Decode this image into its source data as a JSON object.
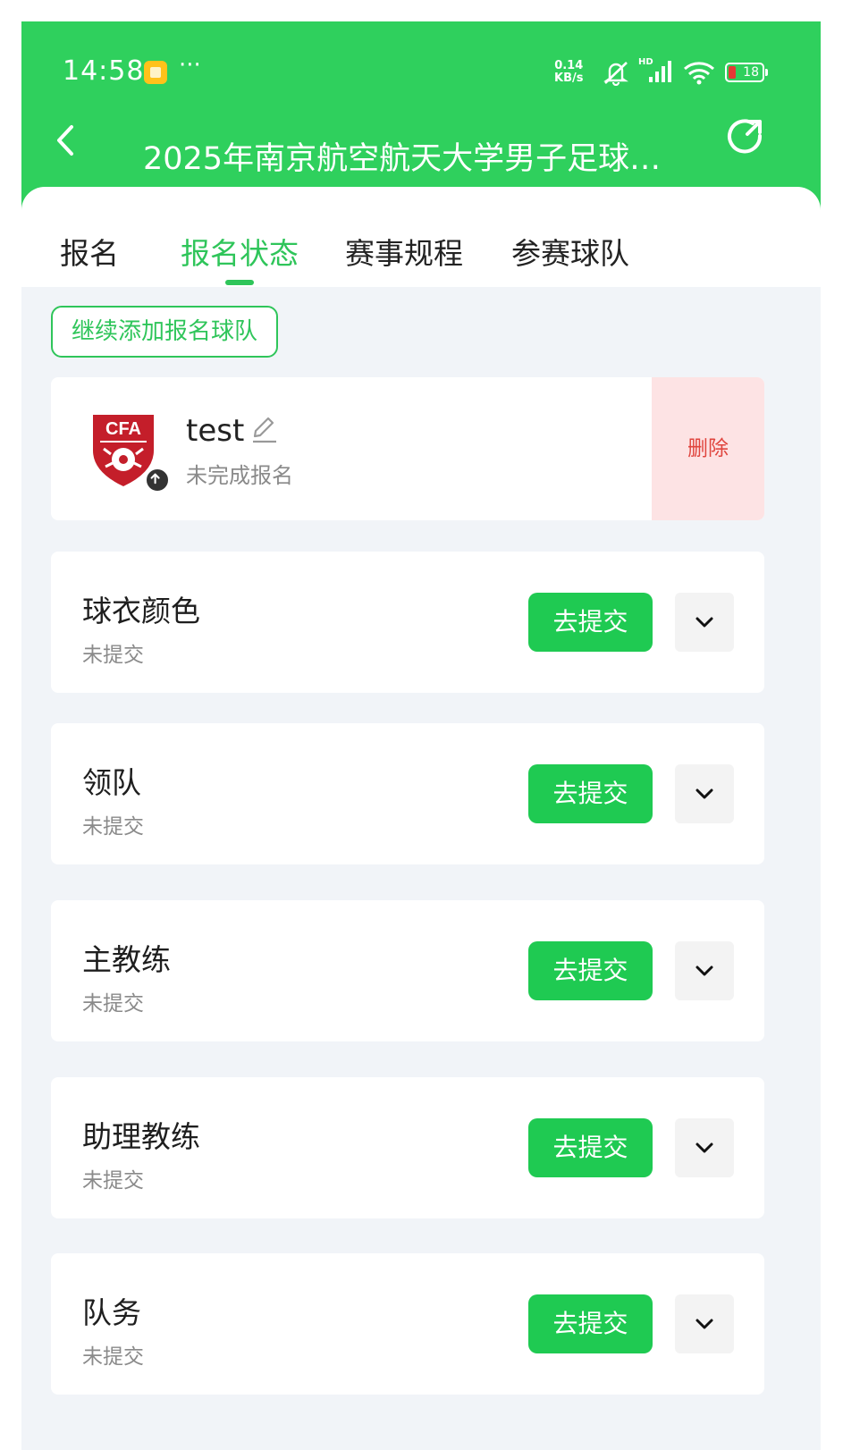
{
  "status_bar": {
    "time": "14:58",
    "net_speed_value": "0.14",
    "net_speed_unit": "KB/s",
    "hd_label": "HD",
    "battery": "18"
  },
  "header": {
    "title": "2025年南京航空航天大学男子足球…"
  },
  "tabs": [
    {
      "label": "报名"
    },
    {
      "label": "报名状态"
    },
    {
      "label": "赛事规程"
    },
    {
      "label": "参赛球队"
    }
  ],
  "add_team_label": "继续添加报名球队",
  "team": {
    "logo_text": "CFA",
    "name": "test",
    "status": "未完成报名",
    "delete_label": "删除"
  },
  "sections": [
    {
      "title": "球衣颜色",
      "status": "未提交",
      "action": "去提交"
    },
    {
      "title": "领队",
      "status": "未提交",
      "action": "去提交"
    },
    {
      "title": "主教练",
      "status": "未提交",
      "action": "去提交"
    },
    {
      "title": "助理教练",
      "status": "未提交",
      "action": "去提交"
    },
    {
      "title": "队务",
      "status": "未提交",
      "action": "去提交"
    }
  ],
  "colors": {
    "header": "#2fd05d",
    "accent": "#2fc55a",
    "submit_button": "#1fca52",
    "delete_bg": "#fde3e4",
    "delete_text": "#e0453e"
  }
}
